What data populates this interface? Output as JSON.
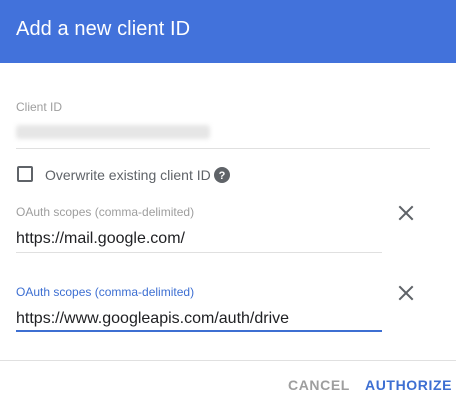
{
  "dialog": {
    "title": "Add a new client ID",
    "client_id": {
      "label": "Client ID"
    },
    "overwrite": {
      "label": "Overwrite existing client ID",
      "checked": false
    },
    "scopes": [
      {
        "label": "OAuth scopes (comma-delimited)",
        "value": "https://mail.google.com/",
        "focused": false
      },
      {
        "label": "OAuth scopes (comma-delimited)",
        "value": "https://www.googleapis.com/auth/drive",
        "focused": true
      }
    ],
    "actions": {
      "cancel": "CANCEL",
      "authorize": "AUTHORIZE"
    },
    "colors": {
      "header": "#4272db",
      "accent": "#3d6fd2",
      "muted": "#9e9e9e"
    },
    "icons": {
      "help": "help-circle-icon",
      "remove": "close-icon"
    }
  }
}
